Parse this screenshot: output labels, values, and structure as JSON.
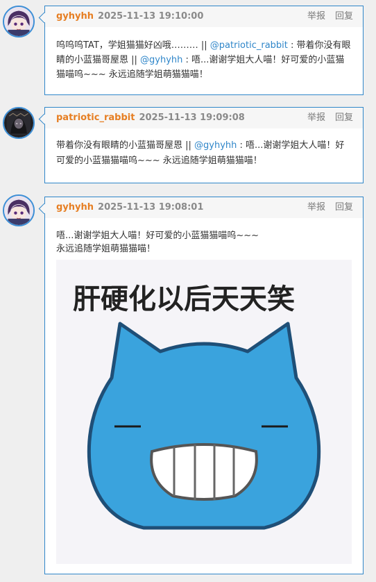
{
  "comments": [
    {
      "author": "gyhyhh",
      "time": "2025-11-13 19:10:00",
      "report_label": "举报",
      "reply_label": "回复",
      "text_a": "呜呜呜TAT，学姐猫猫好凶哦……… || ",
      "mention_a": "@patriotic_rabbit",
      "text_b": " : 带着你没有眼睛的小蓝猫哥屋恩 || ",
      "mention_b": "@gyhyhh",
      "text_c": " : 唔...谢谢学姐大人喵！好可爱的小蓝猫猫喵呜~~~ 永远追随学姐萌猫猫喵！"
    },
    {
      "author": "patriotic_rabbit",
      "time": "2025-11-13 19:09:08",
      "report_label": "举报",
      "reply_label": "回复",
      "text_a": "带着你没有眼睛的小蓝猫哥屋恩 || ",
      "mention_a": "@gyhyhh",
      "text_b": " : 唔...谢谢学姐大人喵！好可爱的小蓝猫猫喵呜~~~ 永远追随学姐萌猫猫喵！"
    },
    {
      "author": "gyhyhh",
      "time": "2025-11-13 19:08:01",
      "report_label": "举报",
      "reply_label": "回复",
      "line1": "唔...谢谢学姐大人喵！好可爱的小蓝猫猫喵呜~~~",
      "line2": "永远追随学姐萌猫猫喵！",
      "sticker_caption": "肝硬化以后天天笑"
    }
  ],
  "colors": {
    "author": "#e67e22",
    "mention": "#2f86c9",
    "card_border": "#2f86c9",
    "cat_blue": "#3aa3dd"
  }
}
